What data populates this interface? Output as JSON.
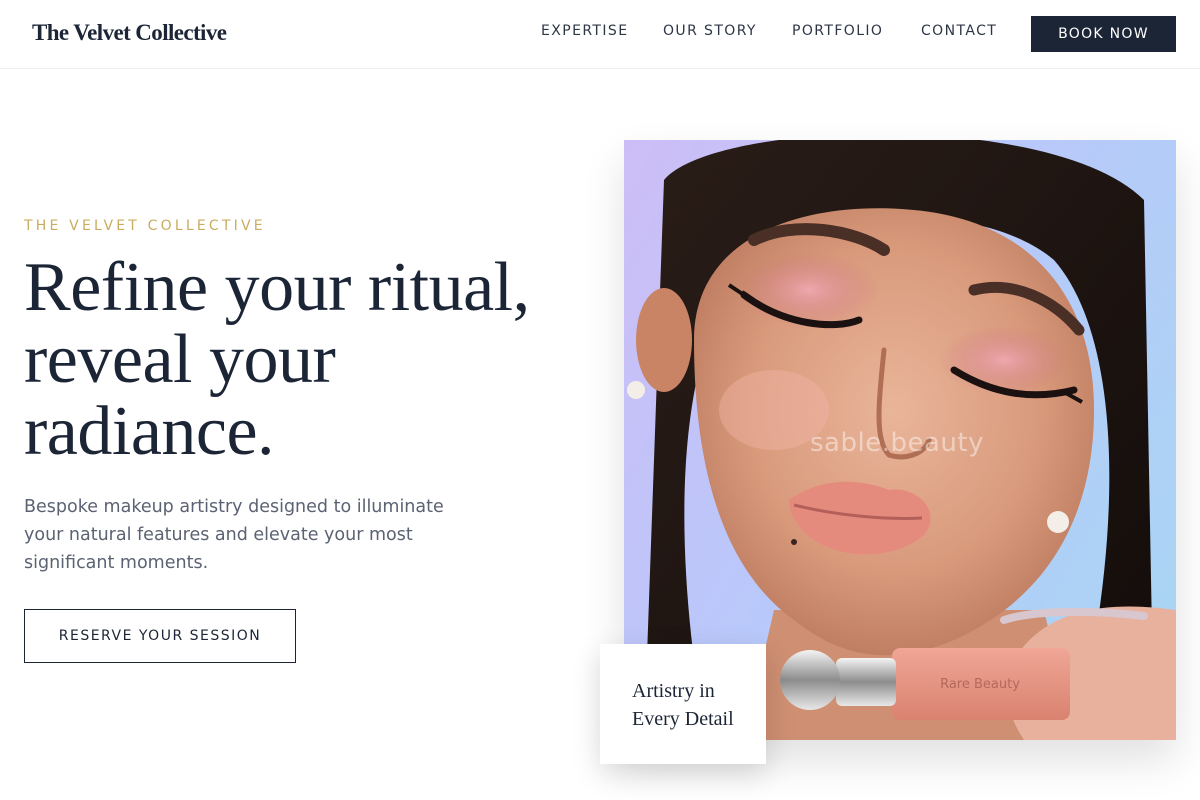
{
  "header": {
    "logo": "The Velvet Collective",
    "nav": [
      "EXPERTISE",
      "OUR STORY",
      "PORTFOLIO",
      "CONTACT"
    ],
    "cta_label": "BOOK NOW"
  },
  "hero": {
    "eyebrow": "THE VELVET COLLECTIVE",
    "headline_lines": [
      "Refine your ritual,",
      "reveal your",
      "radiance."
    ],
    "subtext": "Bespoke makeup artistry designed to illuminate your natural features and elevate your most significant moments.",
    "cta_label": "RESERVE YOUR SESSION"
  },
  "image": {
    "watermark": "sable.beauty",
    "product_label": "Rare Beauty"
  },
  "caption": {
    "lines": [
      "Artistry in",
      "Every Detail"
    ]
  },
  "colors": {
    "navy": "#1c2536",
    "gold": "#c9ac5f",
    "body_text": "#5b6272"
  }
}
